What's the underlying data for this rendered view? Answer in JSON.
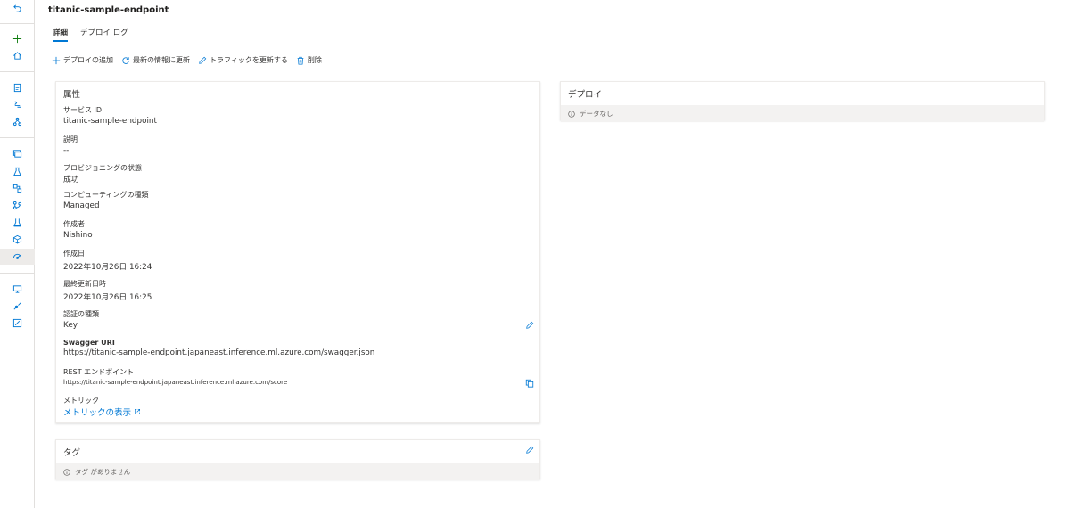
{
  "page": {
    "title": "titanic-sample-endpoint"
  },
  "tabs": [
    {
      "label": "詳細"
    },
    {
      "label": "デプロイ ログ"
    }
  ],
  "toolbar": {
    "add_deploy": "デプロイの追加",
    "refresh": "最新の情報に更新",
    "update_traffic": "トラフィックを更新する",
    "delete": "削除"
  },
  "properties": {
    "title": "属性",
    "service_id_label": "サービス ID",
    "service_id_value": "titanic-sample-endpoint",
    "description_label": "説明",
    "description_value": "--",
    "provisioning_label": "プロビジョニングの状態",
    "provisioning_value": "成功",
    "compute_label": "コンピューティングの種類",
    "compute_value": "Managed",
    "creator_label": "作成者",
    "creator_value": "Nishino",
    "created_label": "作成日",
    "created_value": "2022年10月26日 16:24",
    "updated_label": "最終更新日時",
    "updated_value": "2022年10月26日 16:25",
    "auth_label": "認証の種類",
    "auth_value": "Key",
    "swagger_label": "Swagger URI",
    "swagger_value": "https://titanic-sample-endpoint.japaneast.inference.ml.azure.com/swagger.json",
    "rest_label": "REST エンドポイント",
    "rest_value": "https://titanic-sample-endpoint.japaneast.inference.ml.azure.com/score",
    "metrics_label": "メトリック",
    "metrics_link": "メトリックの表示"
  },
  "deploy_card": {
    "title": "デプロイ",
    "empty": "データなし"
  },
  "tags_card": {
    "title": "タグ",
    "empty": "タグ がありません"
  },
  "colors": {
    "accent": "#0078d4",
    "rail_active": "#edebe9",
    "info_bg": "#f3f2f1"
  }
}
